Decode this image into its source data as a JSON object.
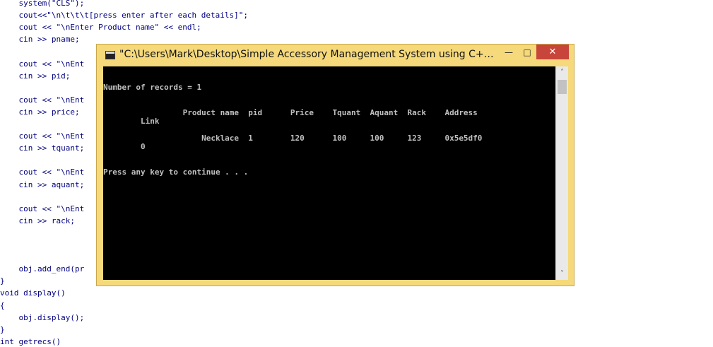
{
  "editor": {
    "lines": [
      "    system(\"CLS\");",
      "    cout<<\"\\n\\t\\t\\t[press enter after each details]\";",
      "    cout << \"\\nEnter Product name\" << endl;",
      "    cin >> pname;",
      "",
      "    cout << \"\\nEnt",
      "    cin >> pid;",
      "",
      "    cout << \"\\nEnt",
      "    cin >> price;",
      "",
      "    cout << \"\\nEnt",
      "    cin >> tquant;",
      "",
      "    cout << \"\\nEnt",
      "    cin >> aquant;",
      "",
      "    cout << \"\\nEnt",
      "    cin >> rack;",
      "",
      "",
      "",
      "    obj.add_end(pr",
      "}",
      "void display()",
      "{",
      "    obj.display();",
      "}",
      "int getrecs()"
    ]
  },
  "console": {
    "title": "\"C:\\Users\\Mark\\Desktop\\Simple Accessory Management System using C++\\Sim...",
    "minimize_glyph": "—",
    "maximize_glyph": "□",
    "close_glyph": "✕",
    "scroll_up_glyph": "˄",
    "scroll_down_glyph": "˅",
    "lines": {
      "records": "Number of records = 1",
      "header1": "                 Product name  pid      Price    Tquant  Aquant  Rack    Address",
      "header2": "        Link",
      "row1": "                     Necklace  1        120      100     100     123     0x5e5df0",
      "row2": "        0",
      "prompt": "Press any key to continue . . ."
    }
  }
}
